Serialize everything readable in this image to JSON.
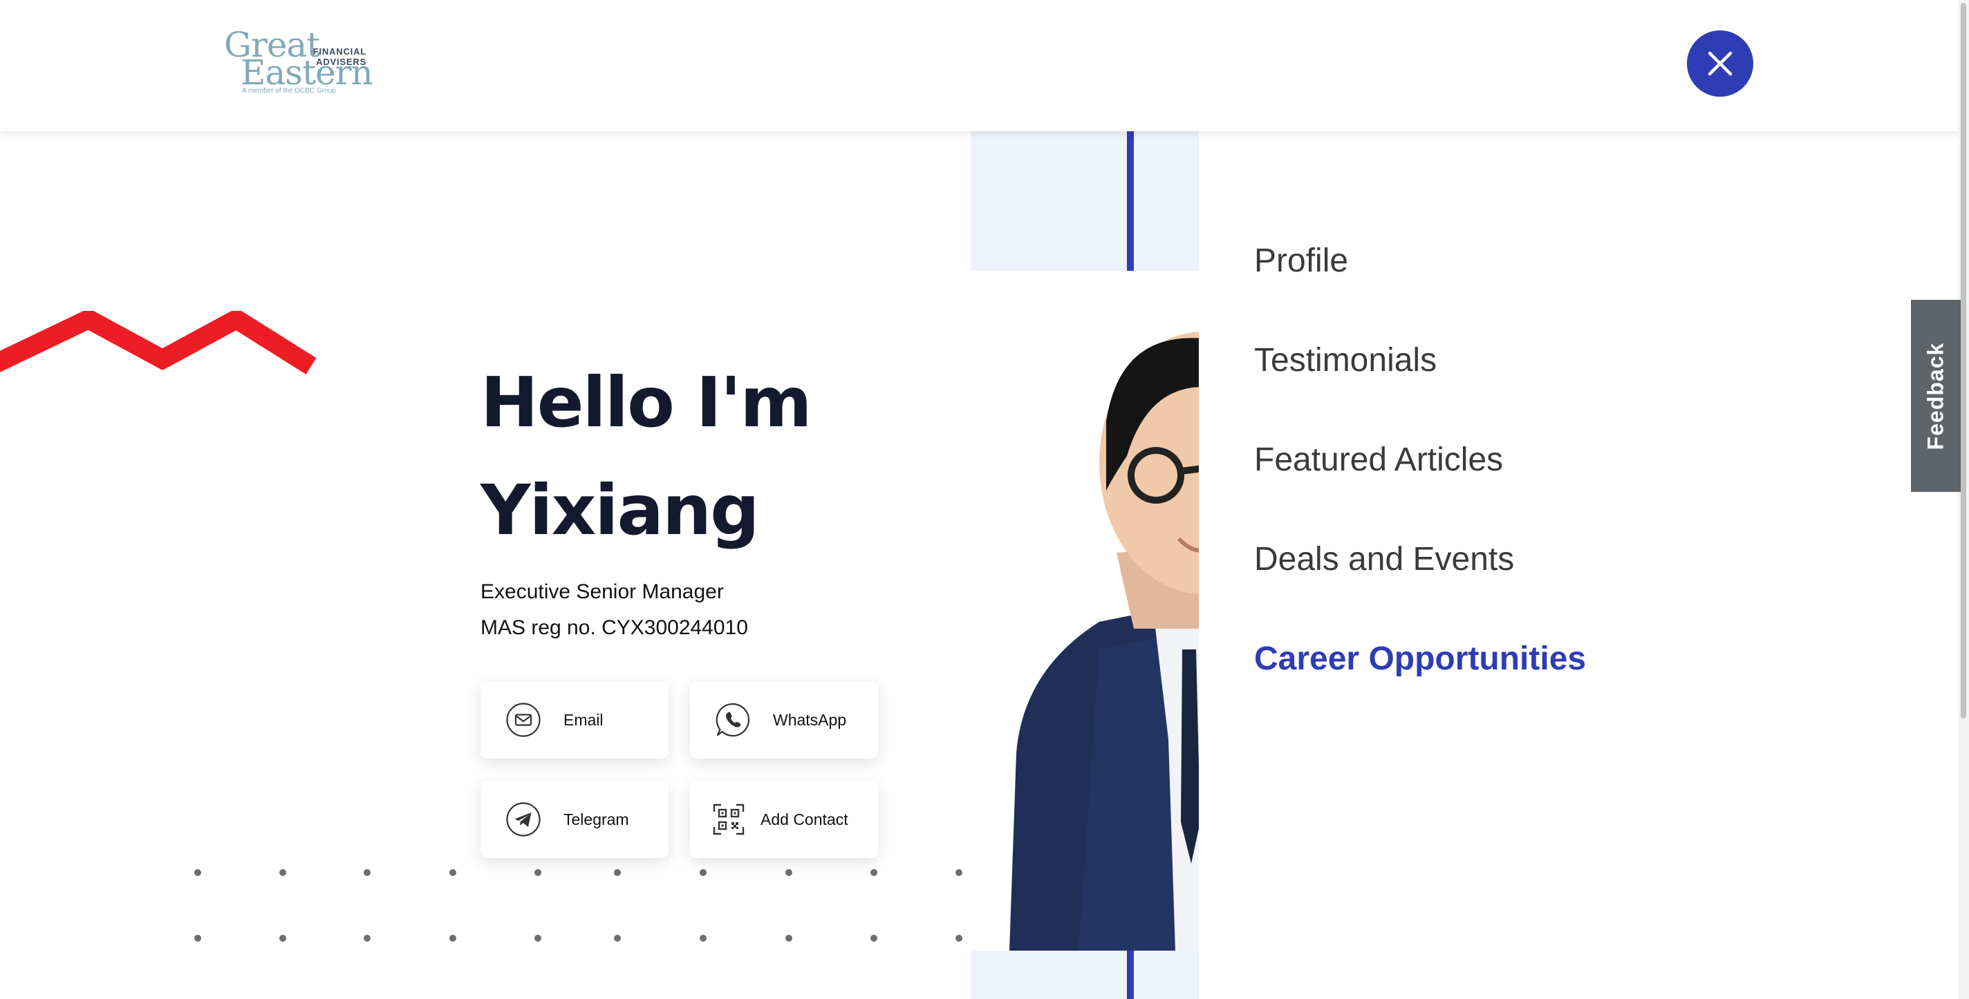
{
  "header": {
    "logo": {
      "line1": "Great",
      "line2": "Eastern",
      "tag_line1": "FINANCIAL",
      "tag_line2": "ADVISERS",
      "member_text": "A member of the OCBC Group"
    },
    "close_icon": "close-icon"
  },
  "hero": {
    "greeting_line1": "Hello I'm",
    "greeting_line2": "Yixiang",
    "job_title": "Executive Senior Manager",
    "mas_reg": "MAS reg no. CYX300244010",
    "contact_buttons": [
      {
        "label": "Email",
        "icon": "email-icon"
      },
      {
        "label": "WhatsApp",
        "icon": "whatsapp-icon"
      },
      {
        "label": "Telegram",
        "icon": "telegram-icon"
      },
      {
        "label": "Add Contact",
        "icon": "qr-code-icon"
      }
    ]
  },
  "menu": {
    "items": [
      {
        "label": "Profile",
        "active": false
      },
      {
        "label": "Testimonials",
        "active": false
      },
      {
        "label": "Featured Articles",
        "active": false
      },
      {
        "label": "Deals and Events",
        "active": false
      },
      {
        "label": "Career Opportunities",
        "active": true
      }
    ]
  },
  "feedback": {
    "label": "Feedback"
  },
  "colors": {
    "brand_blue": "#2e3db3",
    "accent_red": "#ee1c25",
    "heading": "#141a2e",
    "logo_teal": "#82a9b8",
    "feedback_gray": "#5f6468",
    "panel_tint": "#eef2fd"
  }
}
